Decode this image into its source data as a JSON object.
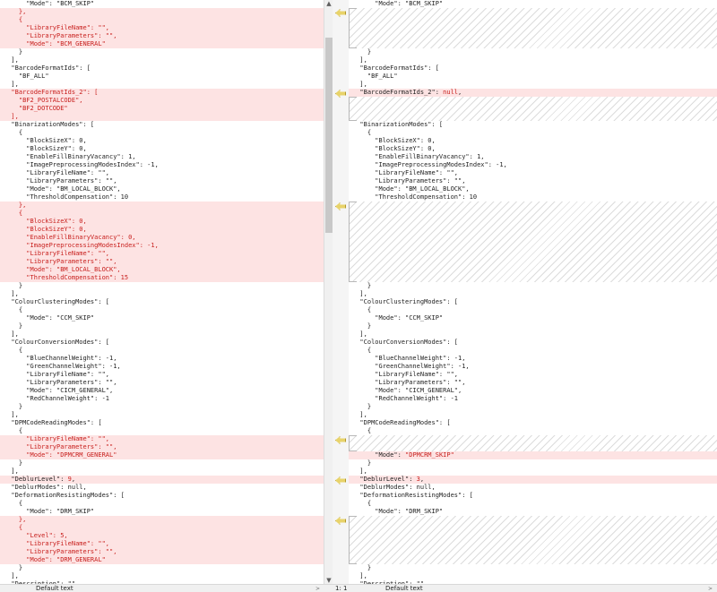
{
  "left_lines": [
    {
      "text": "      \"Mode\": \"BCM_SKIP\"",
      "state": "normal"
    },
    {
      "text": "    },",
      "state": "del"
    },
    {
      "text": "    {",
      "state": "del"
    },
    {
      "text": "      \"LibraryFileName\": \"\",",
      "state": "del"
    },
    {
      "text": "      \"LibraryParameters\": \"\",",
      "state": "del"
    },
    {
      "text": "      \"Mode\": \"BCM_GENERAL\"",
      "state": "del"
    },
    {
      "text": "    }",
      "state": "normal"
    },
    {
      "text": "  ],",
      "state": "normal"
    },
    {
      "text": "  \"BarcodeFormatIds\": [",
      "state": "normal"
    },
    {
      "text": "    \"BF_ALL\"",
      "state": "normal"
    },
    {
      "text": "  ],",
      "state": "normal"
    },
    {
      "text": "  \"BarcodeFormatIds_2\": [",
      "state": "del"
    },
    {
      "text": "    \"BF2_POSTALCODE\",",
      "state": "del"
    },
    {
      "text": "    \"BF2_DOTCODE\"",
      "state": "del"
    },
    {
      "text": "  ],",
      "state": "del"
    },
    {
      "text": "  \"BinarizationModes\": [",
      "state": "normal"
    },
    {
      "text": "    {",
      "state": "normal"
    },
    {
      "text": "      \"BlockSizeX\": 0,",
      "state": "normal"
    },
    {
      "text": "      \"BlockSizeY\": 0,",
      "state": "normal"
    },
    {
      "text": "      \"EnableFillBinaryVacancy\": 1,",
      "state": "normal"
    },
    {
      "text": "      \"ImagePreprocessingModesIndex\": -1,",
      "state": "normal"
    },
    {
      "text": "      \"LibraryFileName\": \"\",",
      "state": "normal"
    },
    {
      "text": "      \"LibraryParameters\": \"\",",
      "state": "normal"
    },
    {
      "text": "      \"Mode\": \"BM_LOCAL_BLOCK\",",
      "state": "normal"
    },
    {
      "text": "      \"ThresholdCompensation\": 10",
      "state": "normal"
    },
    {
      "text": "    },",
      "state": "del"
    },
    {
      "text": "    {",
      "state": "del"
    },
    {
      "text": "      \"BlockSizeX\": 0,",
      "state": "del"
    },
    {
      "text": "      \"BlockSizeY\": 0,",
      "state": "del"
    },
    {
      "text": "      \"EnableFillBinaryVacancy\": 0,",
      "state": "del"
    },
    {
      "text": "      \"ImagePreprocessingModesIndex\": -1,",
      "state": "del"
    },
    {
      "text": "      \"LibraryFileName\": \"\",",
      "state": "del"
    },
    {
      "text": "      \"LibraryParameters\": \"\",",
      "state": "del"
    },
    {
      "text": "      \"Mode\": \"BM_LOCAL_BLOCK\",",
      "state": "del"
    },
    {
      "text": "      \"ThresholdCompensation\": 15",
      "state": "del"
    },
    {
      "text": "    }",
      "state": "normal"
    },
    {
      "text": "  ],",
      "state": "normal"
    },
    {
      "text": "  \"ColourClusteringModes\": [",
      "state": "normal"
    },
    {
      "text": "    {",
      "state": "normal"
    },
    {
      "text": "      \"Mode\": \"CCM_SKIP\"",
      "state": "normal"
    },
    {
      "text": "    }",
      "state": "normal"
    },
    {
      "text": "  ],",
      "state": "normal"
    },
    {
      "text": "  \"ColourConversionModes\": [",
      "state": "normal"
    },
    {
      "text": "    {",
      "state": "normal"
    },
    {
      "text": "      \"BlueChannelWeight\": -1,",
      "state": "normal"
    },
    {
      "text": "      \"GreenChannelWeight\": -1,",
      "state": "normal"
    },
    {
      "text": "      \"LibraryFileName\": \"\",",
      "state": "normal"
    },
    {
      "text": "      \"LibraryParameters\": \"\",",
      "state": "normal"
    },
    {
      "text": "      \"Mode\": \"CICM_GENERAL\",",
      "state": "normal"
    },
    {
      "text": "      \"RedChannelWeight\": -1",
      "state": "normal"
    },
    {
      "text": "    }",
      "state": "normal"
    },
    {
      "text": "  ],",
      "state": "normal"
    },
    {
      "text": "  \"DPMCodeReadingModes\": [",
      "state": "normal"
    },
    {
      "text": "    {",
      "state": "normal"
    },
    {
      "text": "      \"LibraryFileName\": \"\",",
      "state": "del"
    },
    {
      "text": "      \"LibraryParameters\": \"\",",
      "state": "del"
    },
    {
      "text": "      \"Mode\": \"DPMCRM_GENERAL\"",
      "state": "del"
    },
    {
      "text": "    }",
      "state": "normal"
    },
    {
      "text": "  ],",
      "state": "normal"
    },
    {
      "text": "  \"DeblurLevel\": 9,",
      "state": "chg",
      "prefix": "  \"DeblurLevel\": ",
      "changed": "9",
      "suffix": ","
    },
    {
      "text": "  \"DeblurModes\": null,",
      "state": "normal"
    },
    {
      "text": "  \"DeformationResistingModes\": [",
      "state": "normal"
    },
    {
      "text": "    {",
      "state": "normal"
    },
    {
      "text": "      \"Mode\": \"DRM_SKIP\"",
      "state": "normal"
    },
    {
      "text": "    },",
      "state": "del"
    },
    {
      "text": "    {",
      "state": "del"
    },
    {
      "text": "      \"Level\": 5,",
      "state": "del"
    },
    {
      "text": "      \"LibraryFileName\": \"\",",
      "state": "del"
    },
    {
      "text": "      \"LibraryParameters\": \"\",",
      "state": "del"
    },
    {
      "text": "      \"Mode\": \"DRM_GENERAL\"",
      "state": "del"
    },
    {
      "text": "    }",
      "state": "normal"
    },
    {
      "text": "  ],",
      "state": "normal"
    },
    {
      "text": "  \"Description\": \"\",",
      "state": "normal"
    }
  ],
  "right_blocks": [
    {
      "kind": "line",
      "text": "      \"Mode\": \"BCM_SKIP\"",
      "state": "normal"
    },
    {
      "kind": "hatch",
      "rows": 5
    },
    {
      "kind": "line",
      "text": "    }",
      "state": "normal"
    },
    {
      "kind": "line",
      "text": "  ],",
      "state": "normal"
    },
    {
      "kind": "line",
      "text": "  \"BarcodeFormatIds\": [",
      "state": "normal"
    },
    {
      "kind": "line",
      "text": "    \"BF_ALL\"",
      "state": "normal"
    },
    {
      "kind": "line",
      "text": "  ],",
      "state": "normal"
    },
    {
      "kind": "line",
      "text": "  \"BarcodeFormatIds_2\": null,",
      "state": "chg",
      "prefix": "  \"BarcodeFormatIds_2\": ",
      "changed": "null",
      "suffix": ","
    },
    {
      "kind": "hatch",
      "rows": 3
    },
    {
      "kind": "line",
      "text": "  \"BinarizationModes\": [",
      "state": "normal"
    },
    {
      "kind": "line",
      "text": "    {",
      "state": "normal"
    },
    {
      "kind": "line",
      "text": "      \"BlockSizeX\": 0,",
      "state": "normal"
    },
    {
      "kind": "line",
      "text": "      \"BlockSizeY\": 0,",
      "state": "normal"
    },
    {
      "kind": "line",
      "text": "      \"EnableFillBinaryVacancy\": 1,",
      "state": "normal"
    },
    {
      "kind": "line",
      "text": "      \"ImagePreprocessingModesIndex\": -1,",
      "state": "normal"
    },
    {
      "kind": "line",
      "text": "      \"LibraryFileName\": \"\",",
      "state": "normal"
    },
    {
      "kind": "line",
      "text": "      \"LibraryParameters\": \"\",",
      "state": "normal"
    },
    {
      "kind": "line",
      "text": "      \"Mode\": \"BM_LOCAL_BLOCK\",",
      "state": "normal"
    },
    {
      "kind": "line",
      "text": "      \"ThresholdCompensation\": 10",
      "state": "normal"
    },
    {
      "kind": "hatch",
      "rows": 10
    },
    {
      "kind": "line",
      "text": "    }",
      "state": "normal"
    },
    {
      "kind": "line",
      "text": "  ],",
      "state": "normal"
    },
    {
      "kind": "line",
      "text": "  \"ColourClusteringModes\": [",
      "state": "normal"
    },
    {
      "kind": "line",
      "text": "    {",
      "state": "normal"
    },
    {
      "kind": "line",
      "text": "      \"Mode\": \"CCM_SKIP\"",
      "state": "normal"
    },
    {
      "kind": "line",
      "text": "    }",
      "state": "normal"
    },
    {
      "kind": "line",
      "text": "  ],",
      "state": "normal"
    },
    {
      "kind": "line",
      "text": "  \"ColourConversionModes\": [",
      "state": "normal"
    },
    {
      "kind": "line",
      "text": "    {",
      "state": "normal"
    },
    {
      "kind": "line",
      "text": "      \"BlueChannelWeight\": -1,",
      "state": "normal"
    },
    {
      "kind": "line",
      "text": "      \"GreenChannelWeight\": -1,",
      "state": "normal"
    },
    {
      "kind": "line",
      "text": "      \"LibraryFileName\": \"\",",
      "state": "normal"
    },
    {
      "kind": "line",
      "text": "      \"LibraryParameters\": \"\",",
      "state": "normal"
    },
    {
      "kind": "line",
      "text": "      \"Mode\": \"CICM_GENERAL\",",
      "state": "normal"
    },
    {
      "kind": "line",
      "text": "      \"RedChannelWeight\": -1",
      "state": "normal"
    },
    {
      "kind": "line",
      "text": "    }",
      "state": "normal"
    },
    {
      "kind": "line",
      "text": "  ],",
      "state": "normal"
    },
    {
      "kind": "line",
      "text": "  \"DPMCodeReadingModes\": [",
      "state": "normal"
    },
    {
      "kind": "line",
      "text": "    {",
      "state": "normal"
    },
    {
      "kind": "hatch",
      "rows": 2
    },
    {
      "kind": "line",
      "text": "      \"Mode\": \"DPMCRM_SKIP\"",
      "state": "chg",
      "prefix": "      \"Mode\": ",
      "changed": "\"DPMCRM_SKIP\"",
      "suffix": ""
    },
    {
      "kind": "line",
      "text": "    }",
      "state": "normal"
    },
    {
      "kind": "line",
      "text": "  ],",
      "state": "normal"
    },
    {
      "kind": "line",
      "text": "  \"DeblurLevel\": 3,",
      "state": "chg",
      "prefix": "  \"DeblurLevel\": ",
      "changed": "3",
      "suffix": ","
    },
    {
      "kind": "line",
      "text": "  \"DeblurModes\": null,",
      "state": "normal"
    },
    {
      "kind": "line",
      "text": "  \"DeformationResistingModes\": [",
      "state": "normal"
    },
    {
      "kind": "line",
      "text": "    {",
      "state": "normal"
    },
    {
      "kind": "line",
      "text": "      \"Mode\": \"DRM_SKIP\"",
      "state": "normal"
    },
    {
      "kind": "hatch",
      "rows": 6
    },
    {
      "kind": "line",
      "text": "    }",
      "state": "normal"
    },
    {
      "kind": "line",
      "text": "  ],",
      "state": "normal"
    },
    {
      "kind": "line",
      "text": "  \"Description\": \"\",",
      "state": "normal"
    }
  ],
  "gutter_markers": [
    1,
    11,
    25,
    54,
    59,
    64
  ],
  "status": {
    "left_mode": "Default text",
    "position": "1: 1",
    "right_mode": "Default text"
  },
  "colors": {
    "deleted_bg": "#fde3e3",
    "deleted_text": "#c8201e",
    "marker": "#e8d36a"
  }
}
